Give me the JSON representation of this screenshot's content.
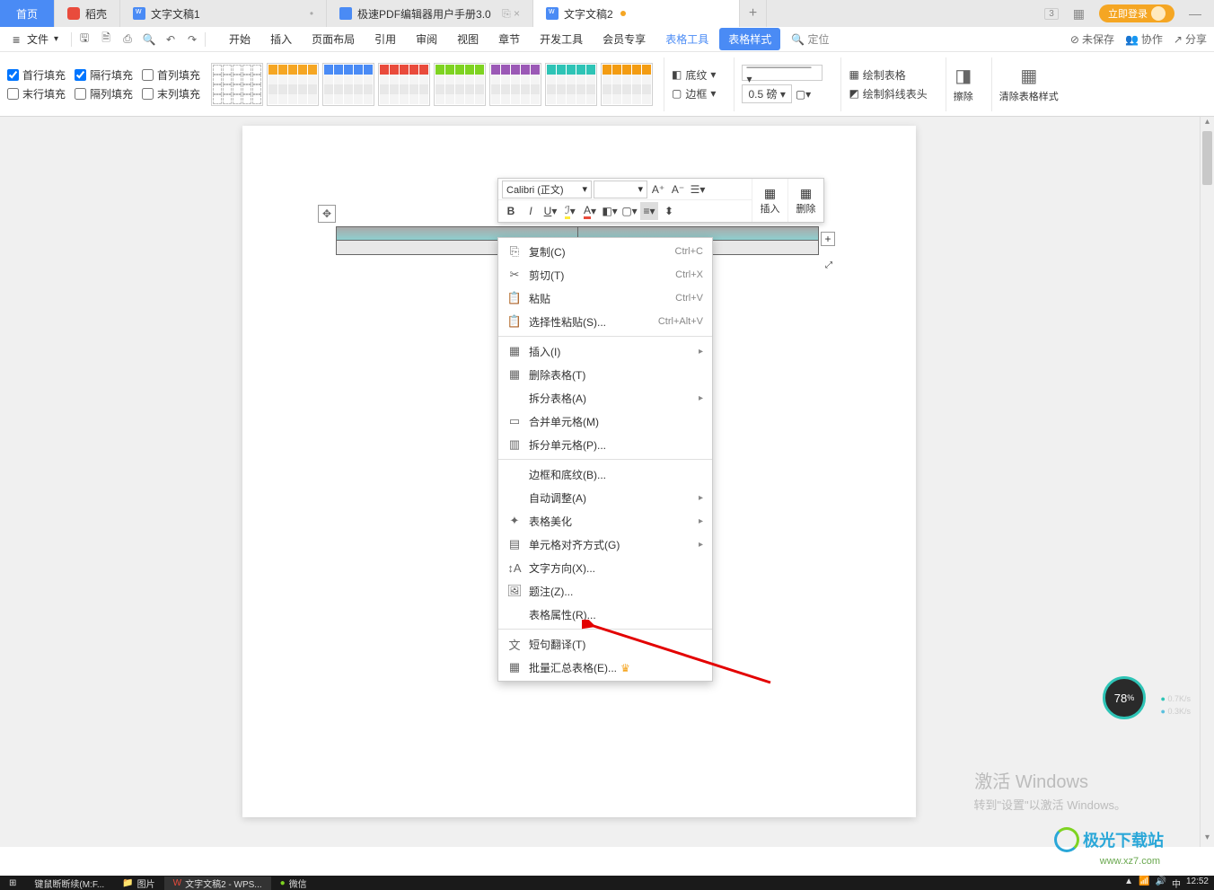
{
  "tabs": {
    "home": "首页",
    "doke": "稻壳",
    "doc1": "文字文稿1",
    "pdf": "极速PDF编辑器用户手册3.0",
    "doc2": "文字文稿2",
    "add": "+"
  },
  "titlebar_right": {
    "login": "立即登录",
    "box1": "3",
    "minimize": "—"
  },
  "file_menu": "文件",
  "menus": {
    "start": "开始",
    "insert": "插入",
    "layout": "页面布局",
    "reference": "引用",
    "review": "审阅",
    "view": "视图",
    "chapter": "章节",
    "devtools": "开发工具",
    "vip": "会员专享",
    "table_tools": "表格工具",
    "table_style": "表格样式",
    "locate": "定位"
  },
  "menurow_right": {
    "unsaved": "未保存",
    "coop": "协作",
    "share": "分享"
  },
  "fill_checks": {
    "first_row": "首行填充",
    "alt_row": "隔行填充",
    "first_col": "首列填充",
    "last_row": "末行填充",
    "alt_col": "隔列填充",
    "last_col": "末列填充"
  },
  "ribbon": {
    "shading": "底纹",
    "border": "边框",
    "line_weight": "0.5",
    "line_unit": "磅",
    "draw_table": "绘制表格",
    "draw_diag": "绘制斜线表头",
    "eraser": "擦除",
    "clear_style": "清除表格样式"
  },
  "minitoolbar": {
    "font_name": "Calibri (正文)",
    "font_size": "",
    "insert": "插入",
    "delete": "删除",
    "a_plus": "A⁺",
    "a_minus": "A⁻"
  },
  "context_menu": {
    "copy": "复制(C)",
    "copy_sc": "Ctrl+C",
    "cut": "剪切(T)",
    "cut_sc": "Ctrl+X",
    "paste": "粘贴",
    "paste_sc": "Ctrl+V",
    "paste_special": "选择性粘贴(S)...",
    "paste_special_sc": "Ctrl+Alt+V",
    "insert": "插入(I)",
    "delete_table": "删除表格(T)",
    "split_table": "拆分表格(A)",
    "merge_cells": "合并单元格(M)",
    "split_cells": "拆分单元格(P)...",
    "border_shading": "边框和底纹(B)...",
    "auto_adjust": "自动调整(A)",
    "beautify": "表格美化",
    "cell_align": "单元格对齐方式(G)",
    "text_dir": "文字方向(X)...",
    "caption": "题注(Z)...",
    "table_props": "表格属性(R)...",
    "translate": "短句翻译(T)",
    "batch_sum": "批量汇总表格(E)..."
  },
  "watermark": {
    "activate": "激活 Windows",
    "goto": "转到\"设置\"以激活 Windows。",
    "logo": "极光下载站",
    "site": "www.xz7.com"
  },
  "gauge": {
    "value": "78",
    "pct": "%",
    "up": "0.7K/s",
    "down": "0.3K/s"
  },
  "taskbar": {
    "app1": "键鼠断断续(M:F...",
    "app2": "图片",
    "app3": "文字文稿2 - WPS...",
    "app4": "微信",
    "time": "12:52"
  },
  "style_colors": [
    "#f5a623",
    "#4a8bf5",
    "#e94b3c",
    "#7ed321",
    "#9b59b6",
    "#2ec4b6",
    "#f39c12"
  ]
}
